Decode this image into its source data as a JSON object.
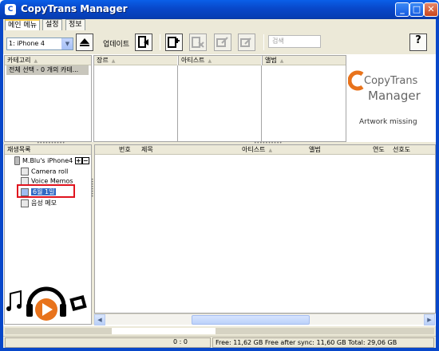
{
  "window": {
    "title": "CopyTrans Manager",
    "icon_letter": "C"
  },
  "tabs": [
    {
      "label": "메인 메뉴"
    },
    {
      "label": "설정"
    },
    {
      "label": "정보"
    }
  ],
  "toolbar": {
    "device": "1: iPhone 4",
    "update_label": "업데이트",
    "search_placeholder": "검색",
    "help_label": "?"
  },
  "browser": {
    "category_header": "카테고리",
    "category_selected": "전체 선택 - 0 개의 카테...",
    "genre_header": "장르",
    "artist_header": "아티스트",
    "album_header": "앨범"
  },
  "artwork": {
    "logo_line1": "CopyTrans",
    "logo_line2": "Manager",
    "missing": "Artwork missing"
  },
  "playlists": {
    "header": "재생목록",
    "device_name": "M.Blu's iPhone4",
    "items": [
      {
        "label": "Camera roll"
      },
      {
        "label": "Voice Memos"
      },
      {
        "label": "6월 1일"
      },
      {
        "label": "음성 메모"
      }
    ]
  },
  "tracklist": {
    "columns": [
      "번호",
      "제목",
      "아티스트",
      "앨범",
      "연도",
      "선호도"
    ]
  },
  "status": {
    "counter": "0 : 0",
    "storage": "Free: 11,62 GB Free after sync: 11,60 GB Total: 29,06 GB"
  },
  "colors": {
    "titlebar": "#0847c9",
    "logo_orange": "#e8731c",
    "selection": "#316ac5",
    "highlight_border": "#e0141e"
  }
}
